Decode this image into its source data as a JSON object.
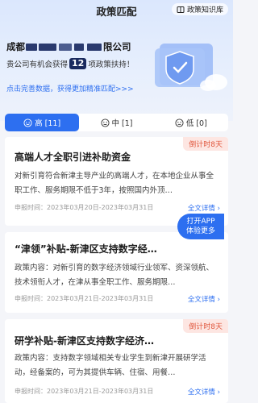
{
  "header": {
    "title": "政策匹配",
    "library_label": "政策知识库"
  },
  "company": {
    "name_prefix": "成都",
    "name_suffix": "限公司"
  },
  "eligibility": {
    "prefix": "贵公司有机会获得",
    "count": "12",
    "suffix": "项政策扶持！"
  },
  "improve_link": "点击完善数据，获得更加精准匹配>>>",
  "tabs": [
    {
      "label": "高 [11]",
      "active": true
    },
    {
      "label": "中 [1]",
      "active": false
    },
    {
      "label": "低 [0]",
      "active": false
    }
  ],
  "policies": [
    {
      "title": "高端人才全职引进补助资金",
      "countdown": "倒计时8天",
      "desc": "对新引育符合新津主导产业的高端人才，在本地企业从事全职工作、服务期限不低于3年，按照国内外顶…",
      "date": "申报时间：2023年03月20日-2023年03月31日",
      "detail": "全文详情 ›"
    },
    {
      "title": "“津领”补贴-新津区支持数字经…",
      "countdown": "",
      "desc": "政策内容：对新引育的数字经济领域行业领军、资深领航、技术领衔人才，在津从事全职工作、服务期限…",
      "date": "申报时间：2023年03月21日-2023年03月31日",
      "detail": "全文详情 ›"
    },
    {
      "title": "研学补贴-新津区支持数字经济…",
      "countdown": "倒计时8天",
      "desc": "政策内容：支持数字领域相关专业学生到新津开展研学活动，经备案的，可为其提供车辆、住宿、用餐…",
      "date": "申报时间：2023年03月21日-2023年03月31日",
      "detail": "全文详情 ›"
    }
  ],
  "float_button": {
    "line1": "打开APP",
    "line2": "体验更多"
  },
  "colors": {
    "accent": "#2d6ff0",
    "countdown_bg": "#fde6e2",
    "countdown_text": "#e0563c",
    "badge": "#1a2a5e"
  }
}
